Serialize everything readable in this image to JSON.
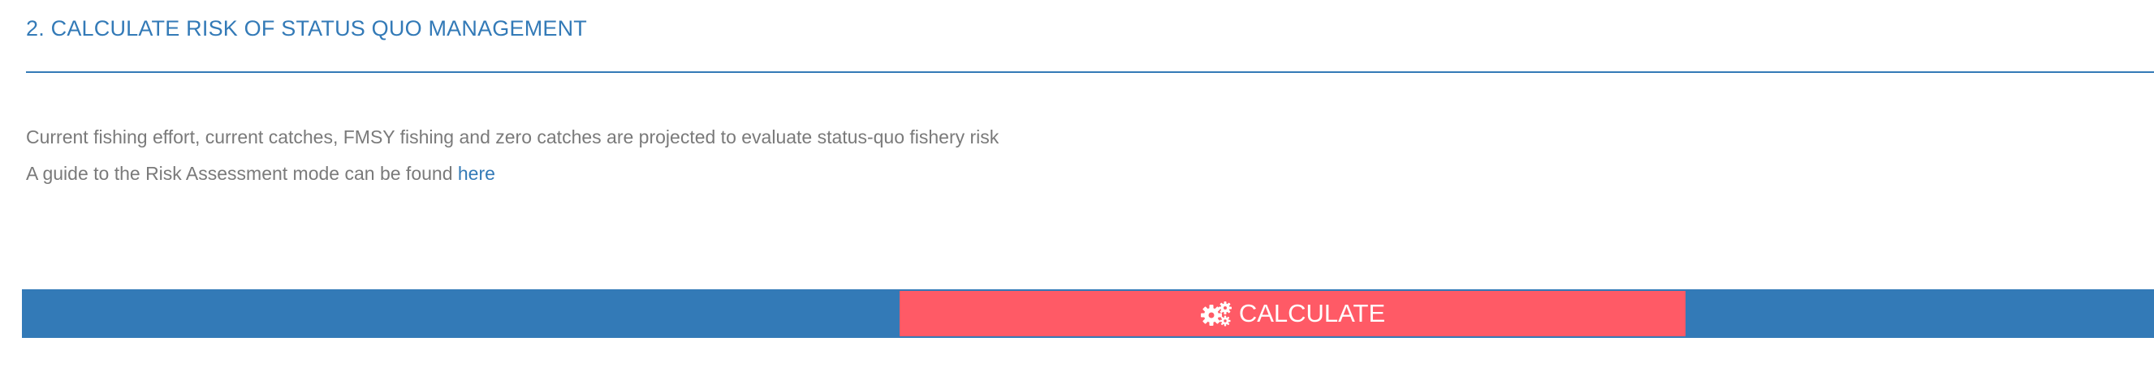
{
  "section": {
    "title": "2. CALCULATE RISK OF STATUS QUO MANAGEMENT"
  },
  "description": {
    "line1": "Current fishing effort, current catches, FMSY fishing and zero catches are projected to evaluate status-quo fishery risk",
    "line2_prefix": "A guide to the Risk Assessment mode can be found ",
    "link_label": "here"
  },
  "action_bar": {
    "calculate_label": "CALCULATE",
    "calculate_icon": "cogs-icon"
  },
  "colors": {
    "accent": "#337ab7",
    "button": "#ff5a66",
    "body_text": "#7a7a7a"
  }
}
